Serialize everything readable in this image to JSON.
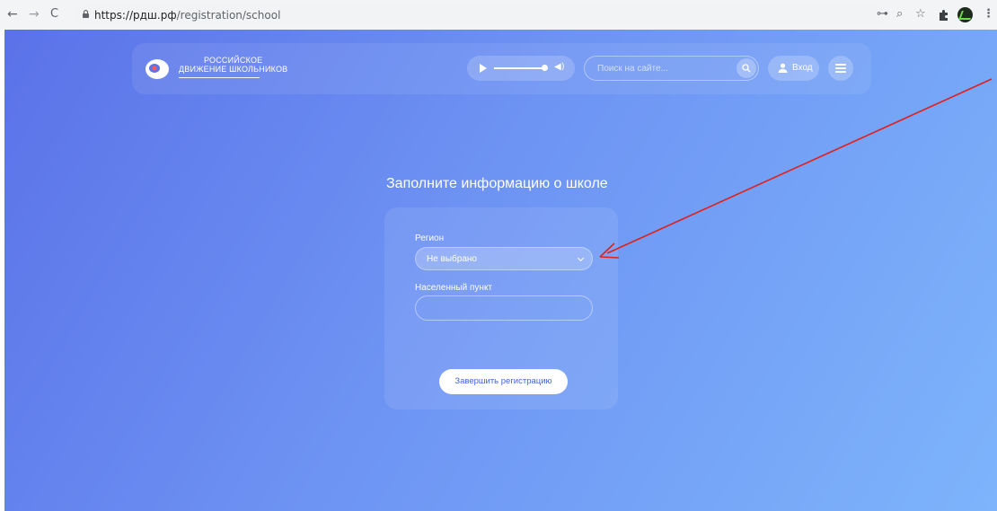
{
  "browser": {
    "url_host": "https://рдш.рф",
    "url_path": "/registration/school",
    "nav": {
      "back": "←",
      "forward": "→",
      "reload": "C"
    },
    "icons": [
      "key-icon",
      "zoom-icon",
      "star-icon",
      "extensions-icon",
      "profile-avatar",
      "menu-icon"
    ]
  },
  "header": {
    "logo_line1": "РОССИЙСКОЕ",
    "logo_line2": "ДВИЖЕНИЕ ШКОЛЬНИКОВ",
    "search_placeholder": "Поиск на сайте...",
    "login_label": "Вход"
  },
  "form": {
    "title": "Заполните информацию о школе",
    "region_label": "Регион",
    "region_value": "Не выбрано",
    "locality_label": "Населенный пункт",
    "locality_value": "",
    "submit_label": "Завершить регистрацию"
  },
  "colors": {
    "gradient_start": "#5b72e8",
    "gradient_end": "#7db4fb",
    "annotation_arrow": "#e0201c"
  }
}
